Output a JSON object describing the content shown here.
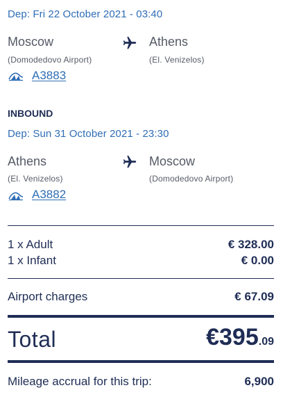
{
  "outbound": {
    "departure": "Dep: Fri 22 October 2021 - 03:40",
    "from_city": "Moscow",
    "from_airport": "(Domodedovo Airport)",
    "to_city": "Athens",
    "to_airport": "(El. Venizelos)",
    "flight_number": "A3883",
    "icons": {
      "plane": "airplane-icon",
      "carrier": "aegean-logo-icon"
    }
  },
  "inbound": {
    "section_title": "INBOUND",
    "departure": "Dep: Sun 31 October 2021 - 23:30",
    "from_city": "Athens",
    "from_airport": "(El. Venizelos)",
    "to_city": "Moscow",
    "to_airport": "(Domodedovo Airport)",
    "flight_number": "A3882",
    "icons": {
      "plane": "airplane-icon",
      "carrier": "aegean-logo-icon"
    }
  },
  "fares": [
    {
      "label": "1 x Adult",
      "value": "€ 328.00"
    },
    {
      "label": "1 x Infant",
      "value": "€ 0.00"
    }
  ],
  "charges": {
    "label": "Airport charges",
    "value": "€ 67.09"
  },
  "total": {
    "label": "Total",
    "currency_integer": "€395",
    "decimals": ".09"
  },
  "mileage": {
    "label": "Mileage accrual for this trip:",
    "value": "6,900"
  },
  "colors": {
    "navy": "#1f2d55",
    "link_blue": "#2f6db5",
    "grey_text": "#555a66"
  }
}
